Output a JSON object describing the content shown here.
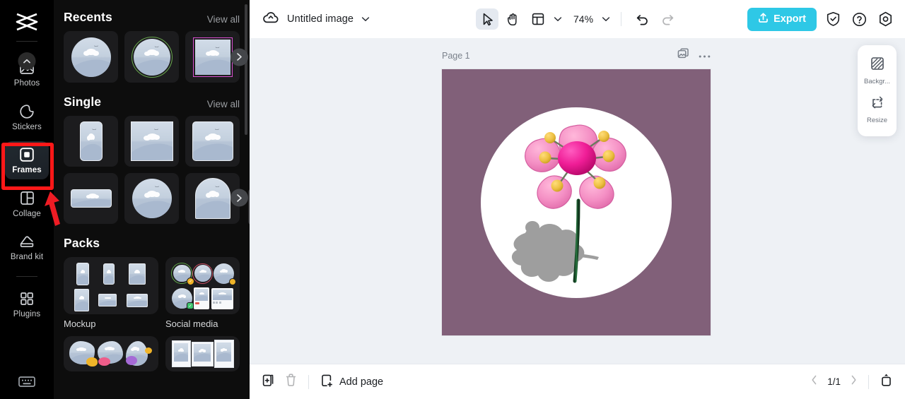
{
  "rail": {
    "logo_icon": "capcut-logo-icon",
    "items": [
      {
        "label": "Photos",
        "icon": "image-icon",
        "badge_icon": "chevron-up-icon",
        "active": false
      },
      {
        "label": "Stickers",
        "icon": "sticker-icon",
        "active": false
      },
      {
        "label": "Frames",
        "icon": "frame-icon",
        "active": true
      },
      {
        "label": "Collage",
        "icon": "collage-icon",
        "active": false
      },
      {
        "label": "Brand kit",
        "icon": "brand-kit-icon",
        "active": false
      },
      {
        "label": "Plugins",
        "icon": "plugins-grid-icon",
        "active": false
      }
    ],
    "bottom_icon": "keyboard-icon"
  },
  "annotation": {
    "highlight_target": "Frames",
    "box_color": "#ff1818",
    "arrow_color": "#ee1c24"
  },
  "panel": {
    "sections": [
      {
        "title": "Recents",
        "view_all": "View all",
        "items": [
          {
            "name": "circle-frame",
            "shape": "circle"
          },
          {
            "name": "circle-ring-frame",
            "shape": "circle-ring",
            "ring_color": "#6aa84f"
          },
          {
            "name": "square-outline-frame",
            "shape": "square-magenta",
            "ring_color": "#d94fd0"
          }
        ]
      },
      {
        "title": "Single",
        "view_all": "View all",
        "items": [
          {
            "name": "portrait-rounded-frame",
            "shape": "portrait"
          },
          {
            "name": "square-frame-a",
            "shape": "square"
          },
          {
            "name": "square-frame-b",
            "shape": "square"
          },
          {
            "name": "landscape-frame",
            "shape": "landscape"
          },
          {
            "name": "circle-frame-2",
            "shape": "circle"
          },
          {
            "name": "arch-frame",
            "shape": "arch"
          }
        ]
      }
    ],
    "packs_title": "Packs",
    "packs": [
      {
        "label": "Mockup",
        "kind": "mockup"
      },
      {
        "label": "Social media",
        "kind": "social"
      },
      {
        "label": "",
        "kind": "blob"
      },
      {
        "label": "",
        "kind": "polaroid"
      }
    ],
    "next_arrow_icon": "chevron-right-icon",
    "collapse_icon": "chevron-left-icon"
  },
  "topbar": {
    "cloud_icon": "cloud-sync-icon",
    "doc_title": "Untitled image",
    "title_chevron_icon": "chevron-down-icon",
    "tools": [
      {
        "name": "select-tool",
        "icon": "cursor-arrow-icon",
        "selected": true
      },
      {
        "name": "hand-tool",
        "icon": "hand-icon",
        "selected": false
      },
      {
        "name": "layout-tool",
        "icon": "layout-icon",
        "selected": false
      }
    ],
    "layout_chevron_icon": "chevron-down-icon",
    "zoom_level": "74%",
    "zoom_chevron_icon": "chevron-down-icon",
    "undo_icon": "undo-icon",
    "redo_icon": "redo-icon",
    "redo_disabled": true,
    "export_label": "Export",
    "export_icon": "upload-icon",
    "export_color": "#2ec8e6",
    "shield_icon": "shield-check-icon",
    "help_icon": "help-circle-icon",
    "settings_icon": "settings-gear-icon"
  },
  "canvas": {
    "page_label": "Page 1",
    "duplicate_icon": "duplicate-image-icon",
    "more_icon": "more-horizontal-icon",
    "background_color": "#816079",
    "circle_color": "#ffffff",
    "artwork": {
      "name": "3d-pink-flower",
      "petal_color": "#f48fc4",
      "center_color": "#e0138a",
      "stamen_color": "#edc042",
      "stem_color": "#1f5e33",
      "shadow_color": "#9e9e9e"
    }
  },
  "float_panel": {
    "items": [
      {
        "label": "Backgr...",
        "icon": "background-icon"
      },
      {
        "label": "Resize",
        "icon": "resize-icon"
      }
    ]
  },
  "bottombar": {
    "duplicate_page_icon": "duplicate-page-icon",
    "delete_page_icon": "trash-icon",
    "delete_disabled": true,
    "add_page_label": "Add page",
    "add_page_icon": "add-page-icon",
    "prev_icon": "chevron-left-icon",
    "page_indicator": "1/1",
    "next_icon": "chevron-right-icon",
    "expand_icon": "expand-panel-icon"
  }
}
